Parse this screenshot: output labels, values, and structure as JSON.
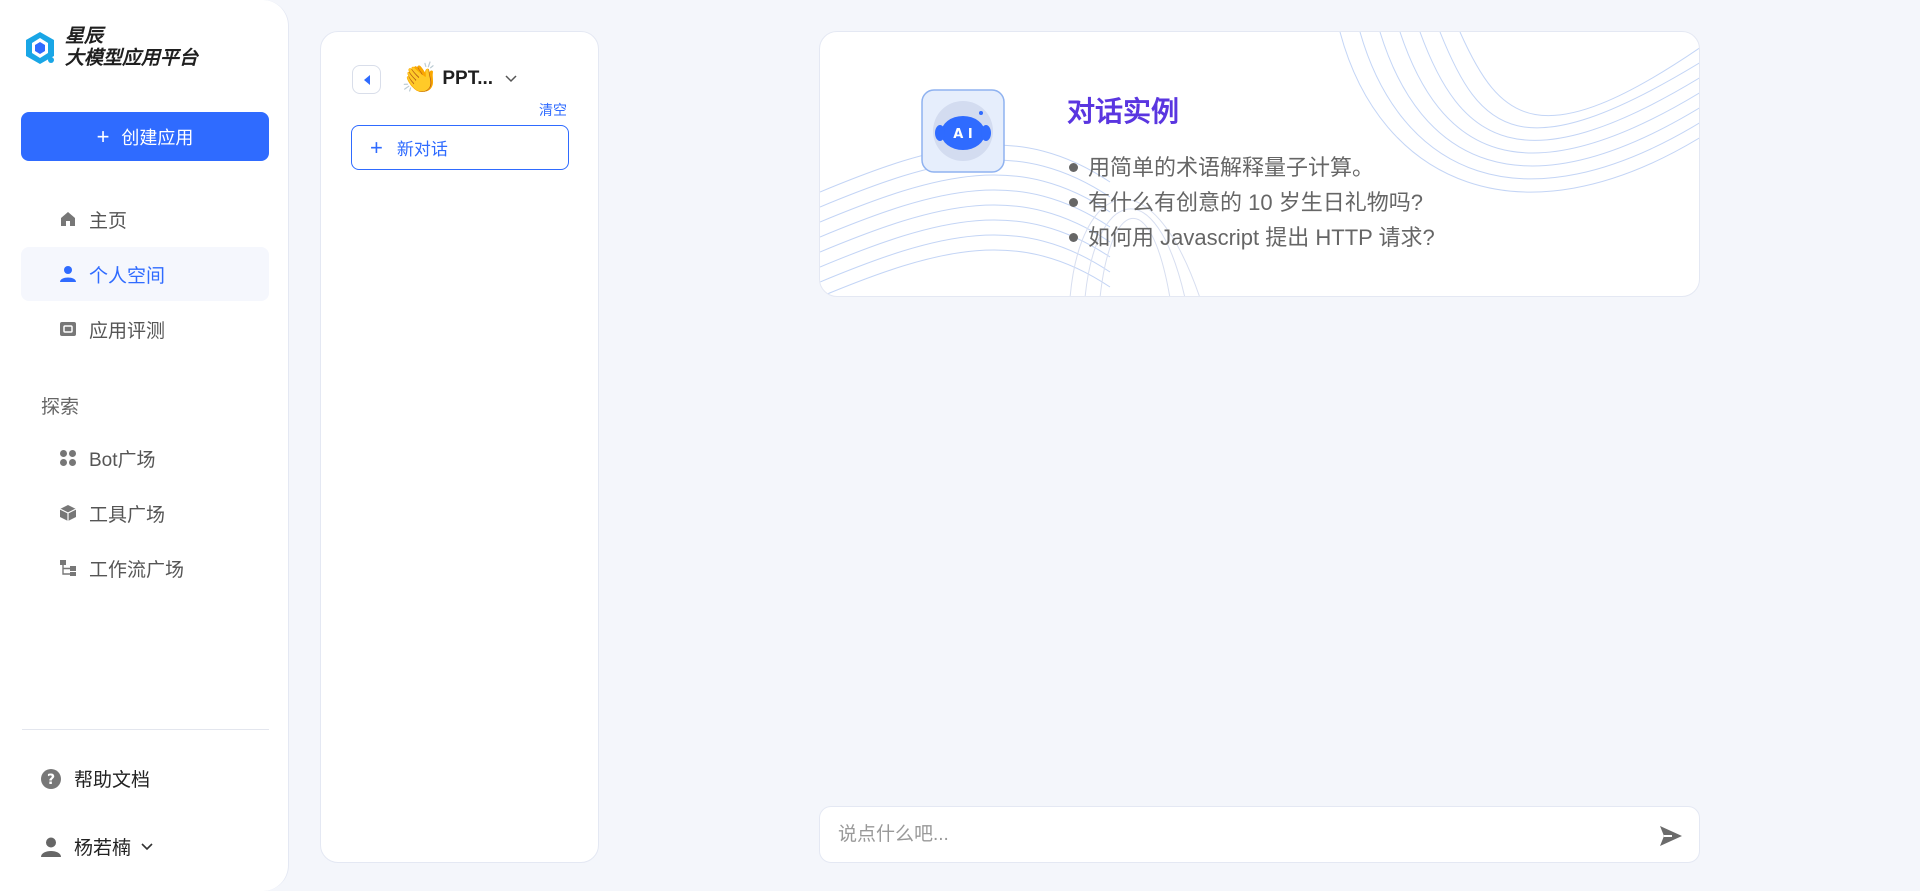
{
  "brand": {
    "line1": "星辰",
    "line2": "大模型应用平台"
  },
  "sidebar": {
    "create_label": "创建应用",
    "nav": [
      {
        "label": "主页",
        "icon": "home-icon"
      },
      {
        "label": "个人空间",
        "icon": "user-icon",
        "active": true
      },
      {
        "label": "应用评测",
        "icon": "evaluate-icon"
      }
    ],
    "explore_label": "探索",
    "explore": [
      {
        "label": "Bot广场",
        "icon": "grid-icon"
      },
      {
        "label": "工具广场",
        "icon": "cube-icon"
      },
      {
        "label": "工作流广场",
        "icon": "workflow-icon"
      }
    ],
    "help_label": "帮助文档",
    "user_name": "杨若楠"
  },
  "conversation": {
    "bot_emoji": "👏",
    "bot_name": "PPT...",
    "clear_label": "清空",
    "new_chat_label": "新对话"
  },
  "examples": {
    "title": "对话实例",
    "items": [
      "用简单的术语解释量子计算。",
      "有什么有创意的 10 岁生日礼物吗?",
      "如何用 Javascript 提出 HTTP 请求?"
    ]
  },
  "input": {
    "placeholder": "说点什么吧..."
  },
  "colors": {
    "accent": "#2f6bff",
    "title_purple": "#5a36e0",
    "background": "#f4f6fb"
  }
}
